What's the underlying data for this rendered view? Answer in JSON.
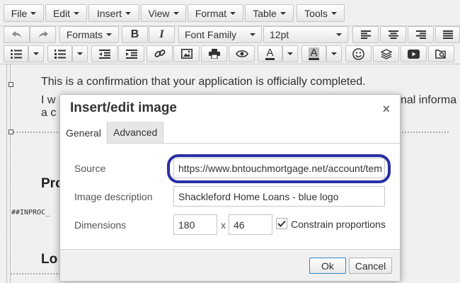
{
  "menubar": {
    "items": [
      {
        "label": "File"
      },
      {
        "label": "Edit"
      },
      {
        "label": "Insert"
      },
      {
        "label": "View"
      },
      {
        "label": "Format"
      },
      {
        "label": "Table"
      },
      {
        "label": "Tools"
      }
    ]
  },
  "toolbar1": {
    "formats_label": "Formats",
    "bold_label": "B",
    "italic_label": "I",
    "font_family_value": "Font Family",
    "font_size_value": "12pt"
  },
  "toolbar2": {
    "text_color_label": "A",
    "bg_color_label": "A"
  },
  "editor": {
    "line1": "This is a confirmation that your application is officially completed.",
    "line2_start": "I w",
    "line2_end": "nal informa",
    "line3_start": "a c",
    "heading1_start": "Pro",
    "inproc_text": "##INPROC_",
    "heading2_start": "Lo"
  },
  "dialog": {
    "title": "Insert/edit image",
    "close_glyph": "×",
    "tabs": [
      {
        "label": "General"
      },
      {
        "label": "Advanced"
      }
    ],
    "fields": {
      "source_label": "Source",
      "source_value": "https://www.bntouchmortgage.net/account/tem",
      "description_label": "Image description",
      "description_value": "Shackleford Home Loans - blue logo",
      "dimensions_label": "Dimensions",
      "width_value": "180",
      "times_sign": "x",
      "height_value": "46",
      "constrain_label": "Constrain proportions",
      "constrain_checked": true
    },
    "ok_label": "Ok",
    "cancel_label": "Cancel"
  },
  "colors": {
    "highlight_red": "#e8141b",
    "highlight_blue": "#2a2fa6",
    "primary_button_border": "#2d8ac7"
  }
}
